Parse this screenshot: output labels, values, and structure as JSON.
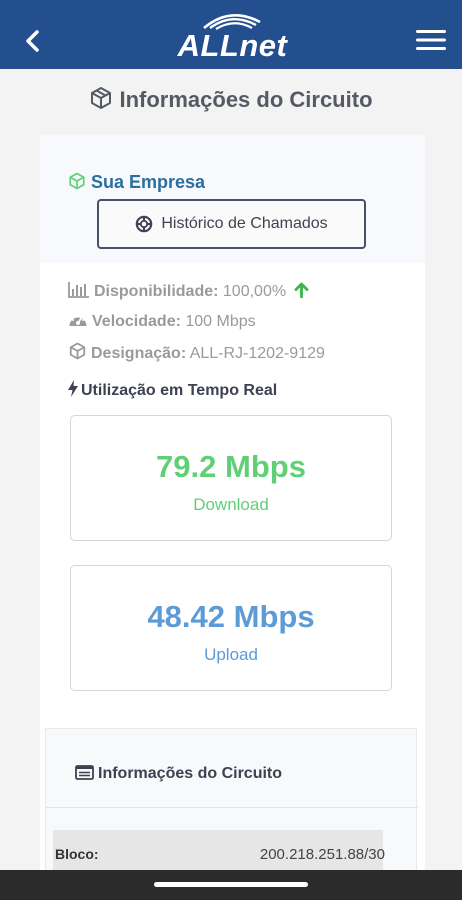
{
  "header": {
    "logo_text": "ALLnet"
  },
  "page": {
    "title": "Informações do Circuito"
  },
  "company": {
    "name": "Sua Empresa",
    "history_button": "Histórico de Chamados"
  },
  "details": {
    "availability_label": "Disponibilidade:",
    "availability_value": "100,00%",
    "speed_label": "Velocidade:",
    "speed_value": "100 Mbps",
    "designation_label": "Designação:",
    "designation_value": "ALL-RJ-1202-9129"
  },
  "realtime": {
    "title": "Utilização em Tempo Real",
    "download_value": "79.2 Mbps",
    "download_label": "Download",
    "upload_value": "48.42 Mbps",
    "upload_label": "Upload"
  },
  "circuit_info": {
    "title": "Informações do Circuito",
    "rows": [
      {
        "label": "Bloco:",
        "value": "200.218.251.88/30"
      }
    ]
  },
  "colors": {
    "header_bg": "#244f8f",
    "download": "#5fd174",
    "upload": "#5c9bd6",
    "company": "#2a6f9f"
  }
}
